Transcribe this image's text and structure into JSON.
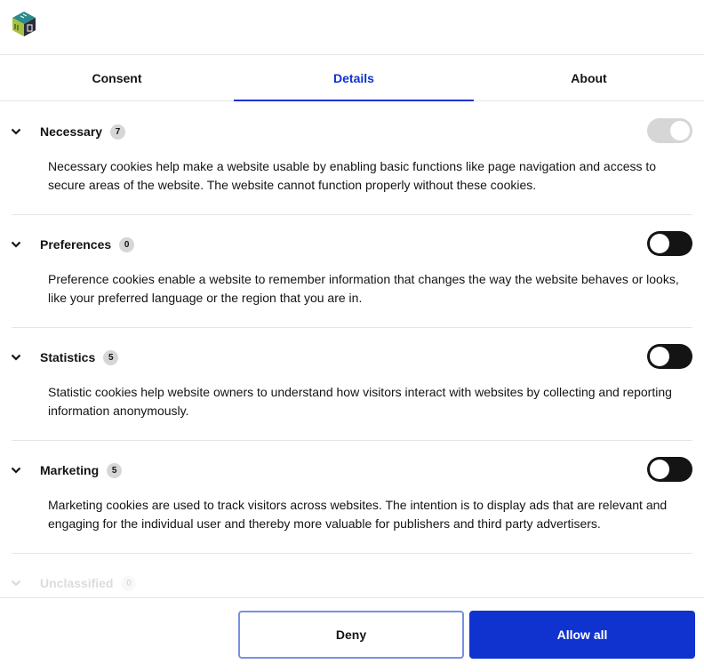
{
  "brand": {
    "logo_icon": "cube-logo-icon",
    "accent_color": "#1032cf"
  },
  "tabs": [
    {
      "label": "Consent",
      "active": false
    },
    {
      "label": "Details",
      "active": true
    },
    {
      "label": "About",
      "active": false
    }
  ],
  "sections": [
    {
      "title": "Necessary",
      "count": "7",
      "toggle_state": "on-disabled",
      "description": "Necessary cookies help make a website usable by enabling basic functions like page navigation and access to secure areas of the website. The website cannot function properly without these cookies."
    },
    {
      "title": "Preferences",
      "count": "0",
      "toggle_state": "off",
      "description": "Preference cookies enable a website to remember information that changes the way the website behaves or looks, like your preferred language or the region that you are in."
    },
    {
      "title": "Statistics",
      "count": "5",
      "toggle_state": "off",
      "description": "Statistic cookies help website owners to understand how visitors interact with websites by collecting and reporting information anonymously."
    },
    {
      "title": "Marketing",
      "count": "5",
      "toggle_state": "off",
      "description": "Marketing cookies are used to track visitors across websites. The intention is to display ads that are relevant and engaging for the individual user and thereby more valuable for publishers and third party advertisers."
    },
    {
      "title": "Unclassified",
      "count": "0"
    }
  ],
  "footer": {
    "deny_label": "Deny",
    "allow_all_label": "Allow all"
  }
}
